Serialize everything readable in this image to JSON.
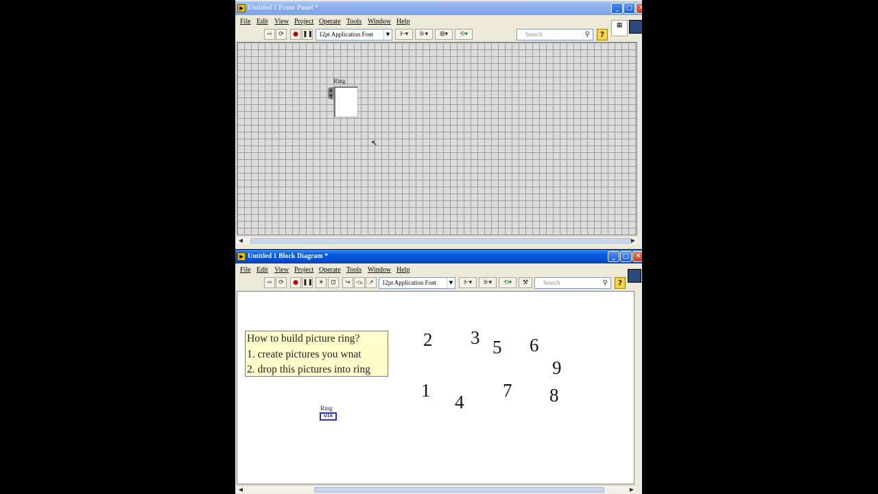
{
  "front_panel": {
    "title": "Untitled 1 Front Panel *",
    "menu": [
      "File",
      "Edit",
      "View",
      "Project",
      "Operate",
      "Tools",
      "Window",
      "Help"
    ],
    "font_select": "12pt Application Font",
    "search_placeholder": "Search",
    "ring_label": "Ring"
  },
  "block_diagram": {
    "title": "Untitled 1 Block Diagram *",
    "menu": [
      "File",
      "Edit",
      "View",
      "Project",
      "Operate",
      "Tools",
      "Window",
      "Help"
    ],
    "font_select": "12pt Application Font",
    "search_placeholder": "Search",
    "comment_lines": [
      "How to build picture ring?",
      "1. create pictures you wnat",
      "2. drop this pictures into ring"
    ],
    "digits": [
      "2",
      "3",
      "5",
      "6",
      "9",
      "1",
      "4",
      "7",
      "8"
    ],
    "ring_label": "Ring",
    "terminal_text": "U16"
  },
  "icons": {
    "minimize": "minimize-icon",
    "maximize": "maximize-icon",
    "close": "close-icon",
    "help": "help-icon",
    "search": "search-icon"
  }
}
